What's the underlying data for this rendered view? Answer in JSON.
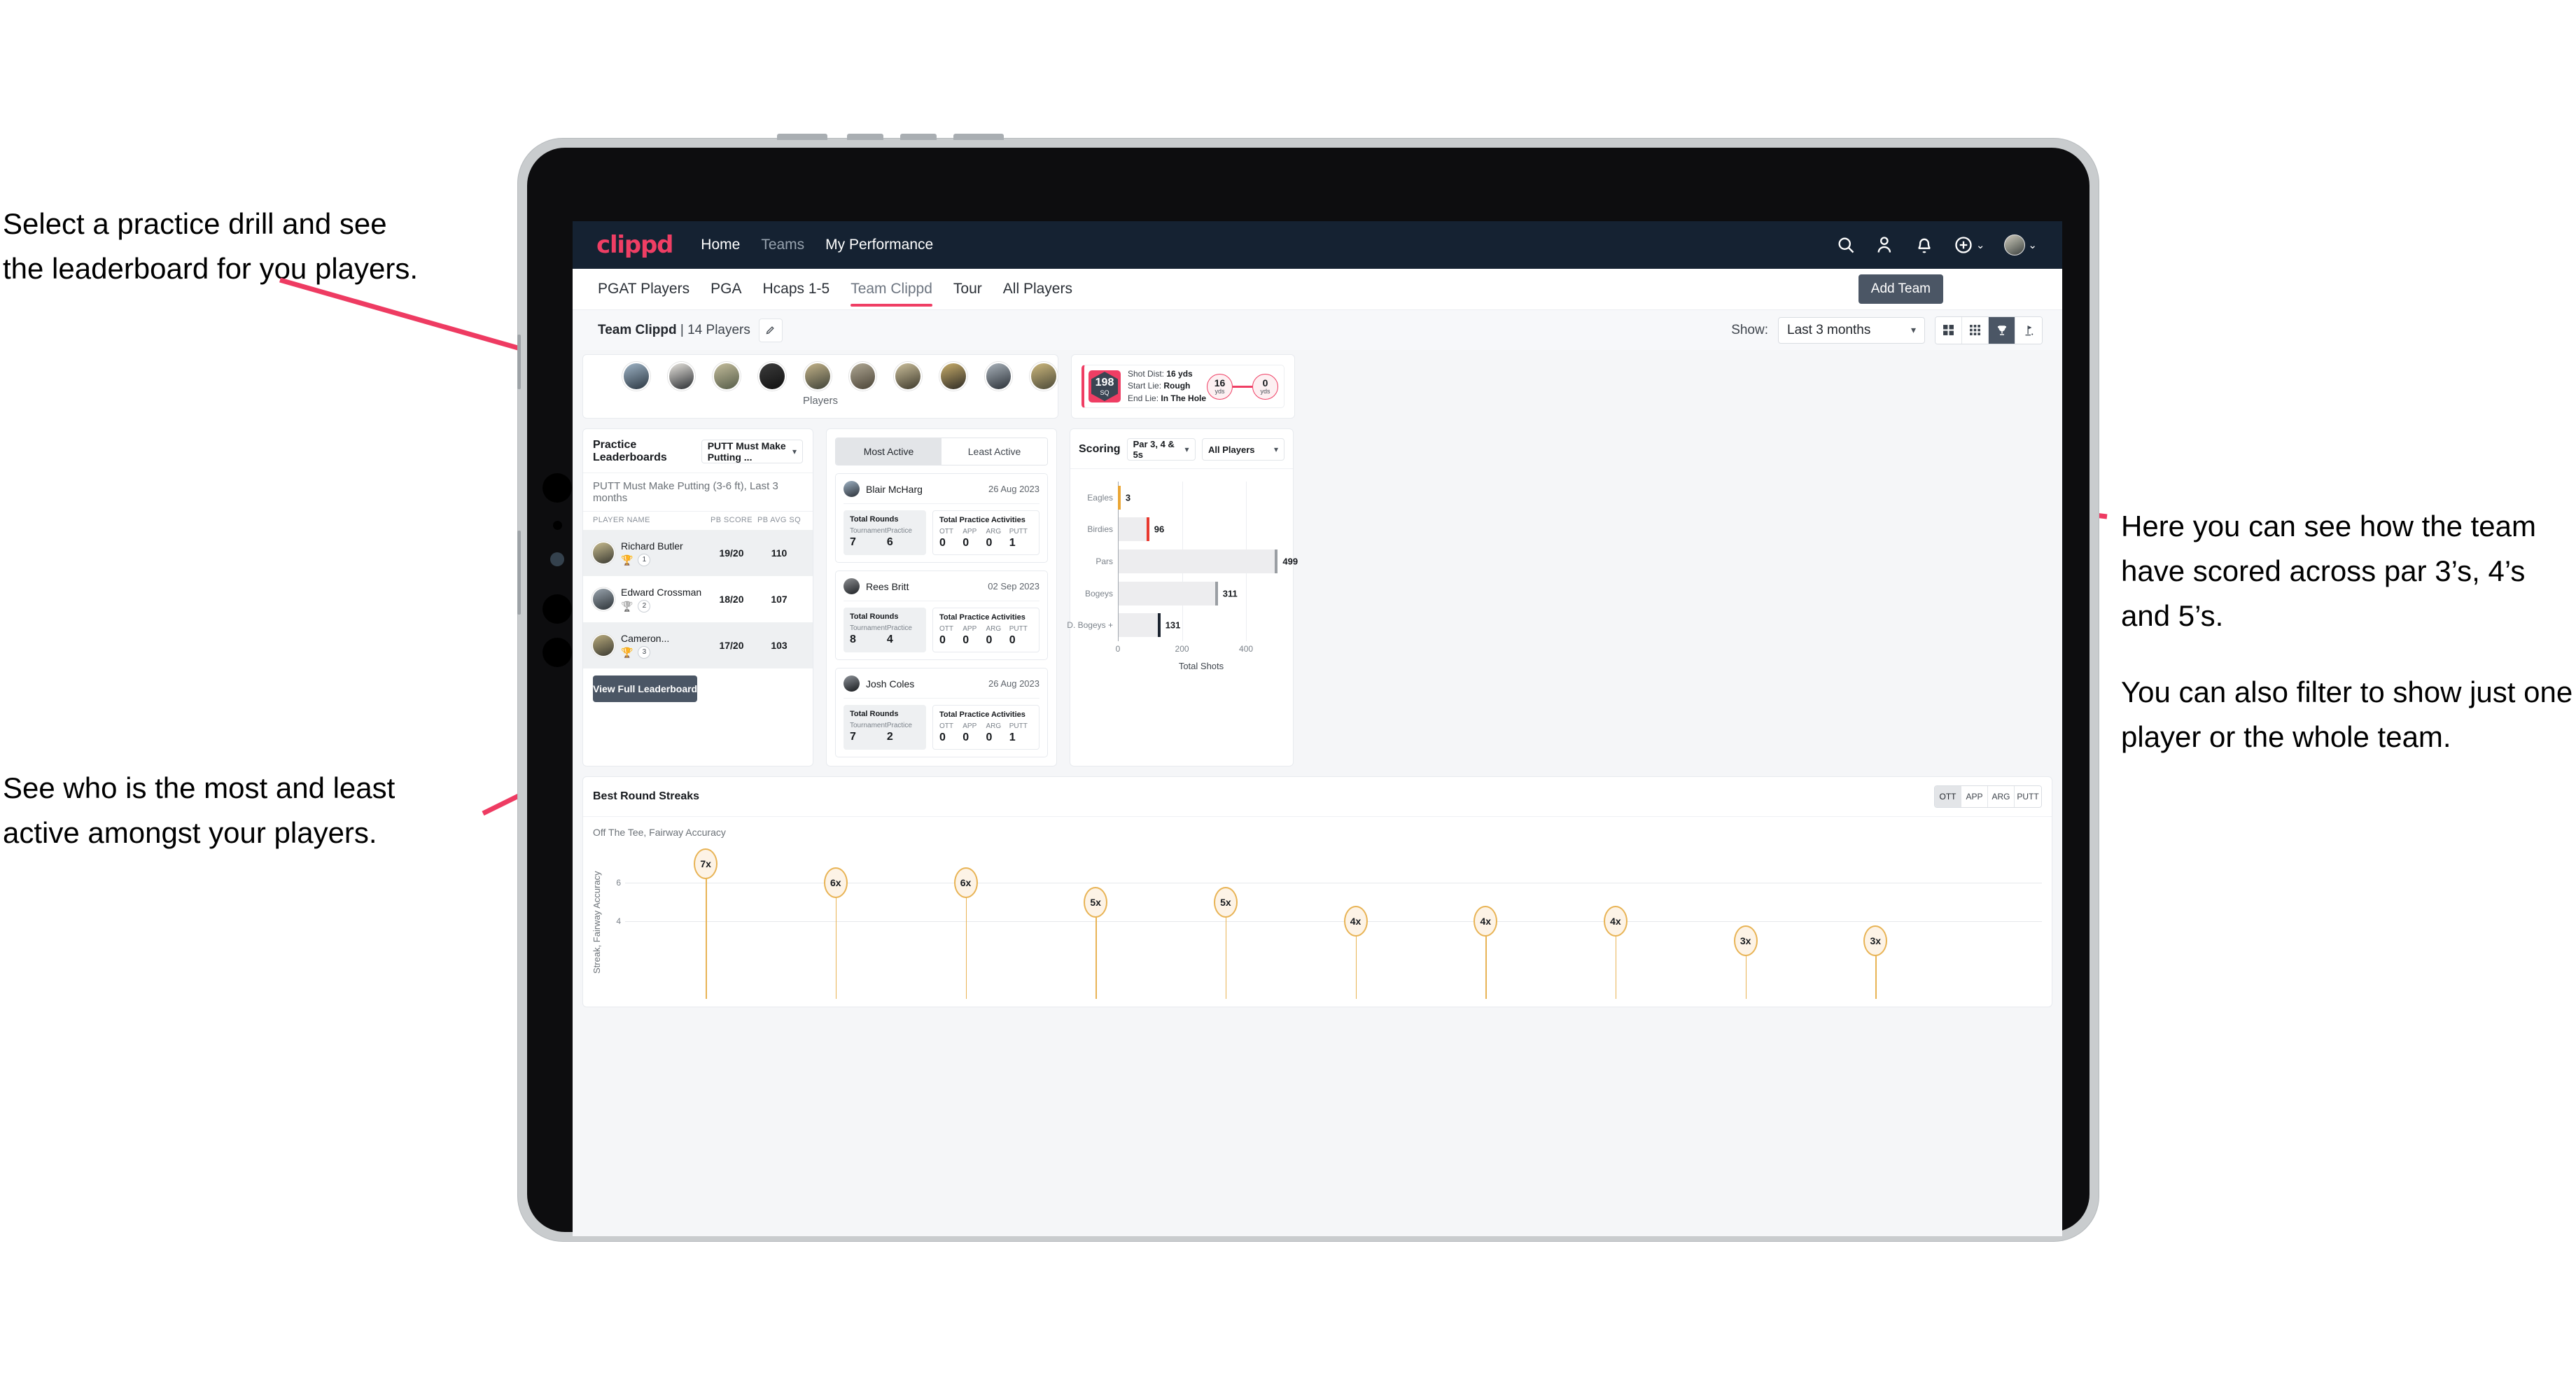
{
  "annotations": {
    "left_top": [
      "Select a practice drill and see",
      "the leaderboard for you players."
    ],
    "left_bottom": [
      "See who is the most and least",
      "active amongst your players."
    ],
    "right": [
      "Here you can see how the team have scored across par 3’s, 4’s and 5’s.",
      "You can also filter to show just one player or the whole team."
    ]
  },
  "navbar": {
    "brand": "clippd",
    "links": [
      {
        "label": "Home",
        "active": true
      },
      {
        "label": "Teams",
        "active": false
      },
      {
        "label": "My Performance",
        "active": true
      }
    ],
    "icons": [
      "search-icon",
      "people-icon",
      "bell-icon",
      "plus-circle-icon",
      "avatar"
    ],
    "caret": "⌄"
  },
  "tabs": [
    {
      "label": "PGAT Players",
      "active": false
    },
    {
      "label": "PGA",
      "active": false
    },
    {
      "label": "Hcaps 1-5",
      "active": false
    },
    {
      "label": "Team Clippd",
      "active": true
    },
    {
      "label": "Tour",
      "active": false
    },
    {
      "label": "All Players",
      "active": false
    }
  ],
  "add_team_button": "Add Team",
  "subheader": {
    "team_name": "Team Clippd",
    "team_count": "| 14 Players",
    "edit_icon": "pencil-icon",
    "show_label": "Show:",
    "show_value": "Last 3 months",
    "view_modes": [
      {
        "name": "grid-view-icon",
        "active": false
      },
      {
        "name": "tile-view-icon",
        "active": false
      },
      {
        "name": "trophy-view-icon",
        "active": true
      },
      {
        "name": "flag-view-icon",
        "active": false
      }
    ]
  },
  "players_card": {
    "axis_label": "Players",
    "avatar_count": 10
  },
  "shot_card": {
    "sq_value": "198",
    "sq_unit": "SQ",
    "lines": [
      {
        "label": "Shot Dist:",
        "value": "16 yds"
      },
      {
        "label": "Start Lie:",
        "value": "Rough"
      },
      {
        "label": "End Lie:",
        "value": "In The Hole"
      }
    ],
    "start_dist": {
      "value": "16",
      "unit": "yds"
    },
    "end_dist": {
      "value": "0",
      "unit": "yds"
    }
  },
  "practice_leaderboards": {
    "title": "Practice Leaderboards",
    "drill_select": "PUTT Must Make Putting ...",
    "subtitle_bold": "PUTT Must Make Putting (3-6 ft),",
    "subtitle_light": "Last 3 months",
    "columns": [
      "PLAYER NAME",
      "PB SCORE",
      "PB AVG SQ"
    ],
    "rows": [
      {
        "name": "Richard Butler",
        "rank": "1",
        "medal": "gold",
        "pb_score": "19/20",
        "pb_avg_sq": "110"
      },
      {
        "name": "Edward Crossman",
        "rank": "2",
        "medal": "silver",
        "pb_score": "18/20",
        "pb_avg_sq": "107"
      },
      {
        "name": "Cameron...",
        "rank": "3",
        "medal": "bronze",
        "pb_score": "17/20",
        "pb_avg_sq": "103"
      }
    ],
    "button": "View Full Leaderboard"
  },
  "activity": {
    "tabs": [
      {
        "label": "Most Active",
        "active": true
      },
      {
        "label": "Least Active",
        "active": false
      }
    ],
    "rounds_header": "Total Rounds",
    "rounds_cols": [
      "Tournament",
      "Practice"
    ],
    "acts_header": "Total Practice Activities",
    "acts_cols": [
      "OTT",
      "APP",
      "ARG",
      "PUTT"
    ],
    "items": [
      {
        "name": "Blair McHarg",
        "date": "26 Aug 2023",
        "tournament": "7",
        "practice": "6",
        "ott": "0",
        "app": "0",
        "arg": "0",
        "putt": "1"
      },
      {
        "name": "Rees Britt",
        "date": "02 Sep 2023",
        "tournament": "8",
        "practice": "4",
        "ott": "0",
        "app": "0",
        "arg": "0",
        "putt": "0"
      },
      {
        "name": "Josh Coles",
        "date": "26 Aug 2023",
        "tournament": "7",
        "practice": "2",
        "ott": "0",
        "app": "0",
        "arg": "0",
        "putt": "1"
      }
    ]
  },
  "scoring": {
    "title": "Scoring",
    "par_select": "Par 3, 4 & 5s",
    "player_select": "All Players"
  },
  "streaks": {
    "title": "Best Round Streaks",
    "toggle": [
      {
        "label": "OTT",
        "active": true
      },
      {
        "label": "APP",
        "active": false
      },
      {
        "label": "ARG",
        "active": false
      },
      {
        "label": "PUTT",
        "active": false
      }
    ],
    "subtitle_bold": "Off The Tee,",
    "subtitle_light": "Fairway Accuracy"
  },
  "chart_data": [
    {
      "type": "bar",
      "orientation": "horizontal",
      "title": "Scoring",
      "categories": [
        "Eagles",
        "Birdies",
        "Pars",
        "Bogeys",
        "D. Bogeys +"
      ],
      "values": [
        3,
        96,
        499,
        311,
        131
      ],
      "cap_colors": [
        "#eaa635",
        "#e8392f",
        "#9a9ea3",
        "#9a9ea3",
        "#1c2430"
      ],
      "xlabel": "Total Shots",
      "ylabel": "",
      "xlim": [
        0,
        520
      ],
      "xticks": [
        0,
        200,
        400
      ],
      "grid": true,
      "legend": "none"
    },
    {
      "type": "bar",
      "variant": "lollipop",
      "title": "Off The Tee, Fairway Accuracy",
      "xlabel": "",
      "ylabel": "Streak, Fairway Accuracy",
      "ylim": [
        0,
        7.6
      ],
      "yticks": [
        4,
        6
      ],
      "grid": true,
      "legend": "none",
      "categories": [
        "",
        "",
        "",
        "",
        "",
        "",
        "",
        "",
        "",
        "",
        ""
      ],
      "values": [
        7,
        6,
        6,
        5,
        5,
        4,
        4,
        4,
        3,
        3
      ],
      "labels": [
        "7x",
        "6x",
        "6x",
        "5x",
        "5x",
        "4x",
        "4x",
        "4x",
        "3x",
        "3x"
      ]
    }
  ]
}
